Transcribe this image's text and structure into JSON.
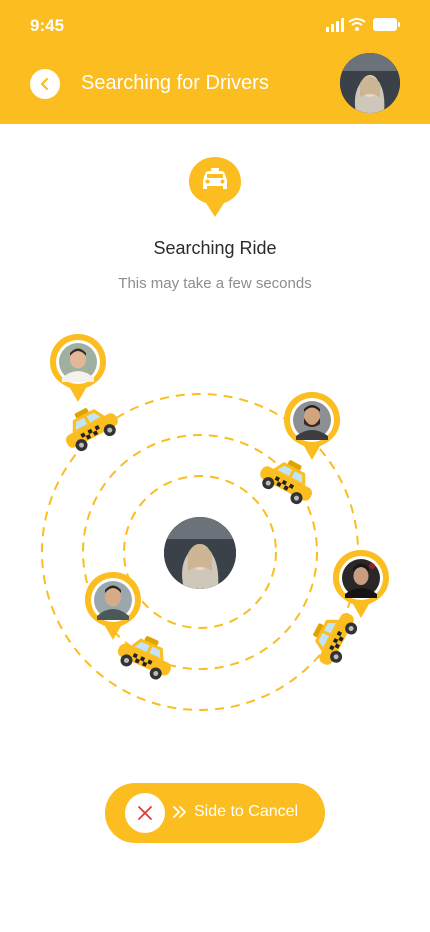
{
  "status_bar": {
    "time": "9:45"
  },
  "header": {
    "title": "Searching for Drivers"
  },
  "search": {
    "heading": "Searching Ride",
    "subheading": "This may take a few seconds"
  },
  "cancel": {
    "label": "Side to Cancel"
  },
  "icons": {
    "back": "chevron-left-icon",
    "taxi": "taxi-icon",
    "cancel": "close-icon",
    "arrows": "double-chevron-right-icon"
  },
  "colors": {
    "accent": "#fbbd1f",
    "white": "#ffffff",
    "danger": "#e53935",
    "text_primary": "#2b2b2b",
    "text_secondary": "#8d8d8d"
  }
}
